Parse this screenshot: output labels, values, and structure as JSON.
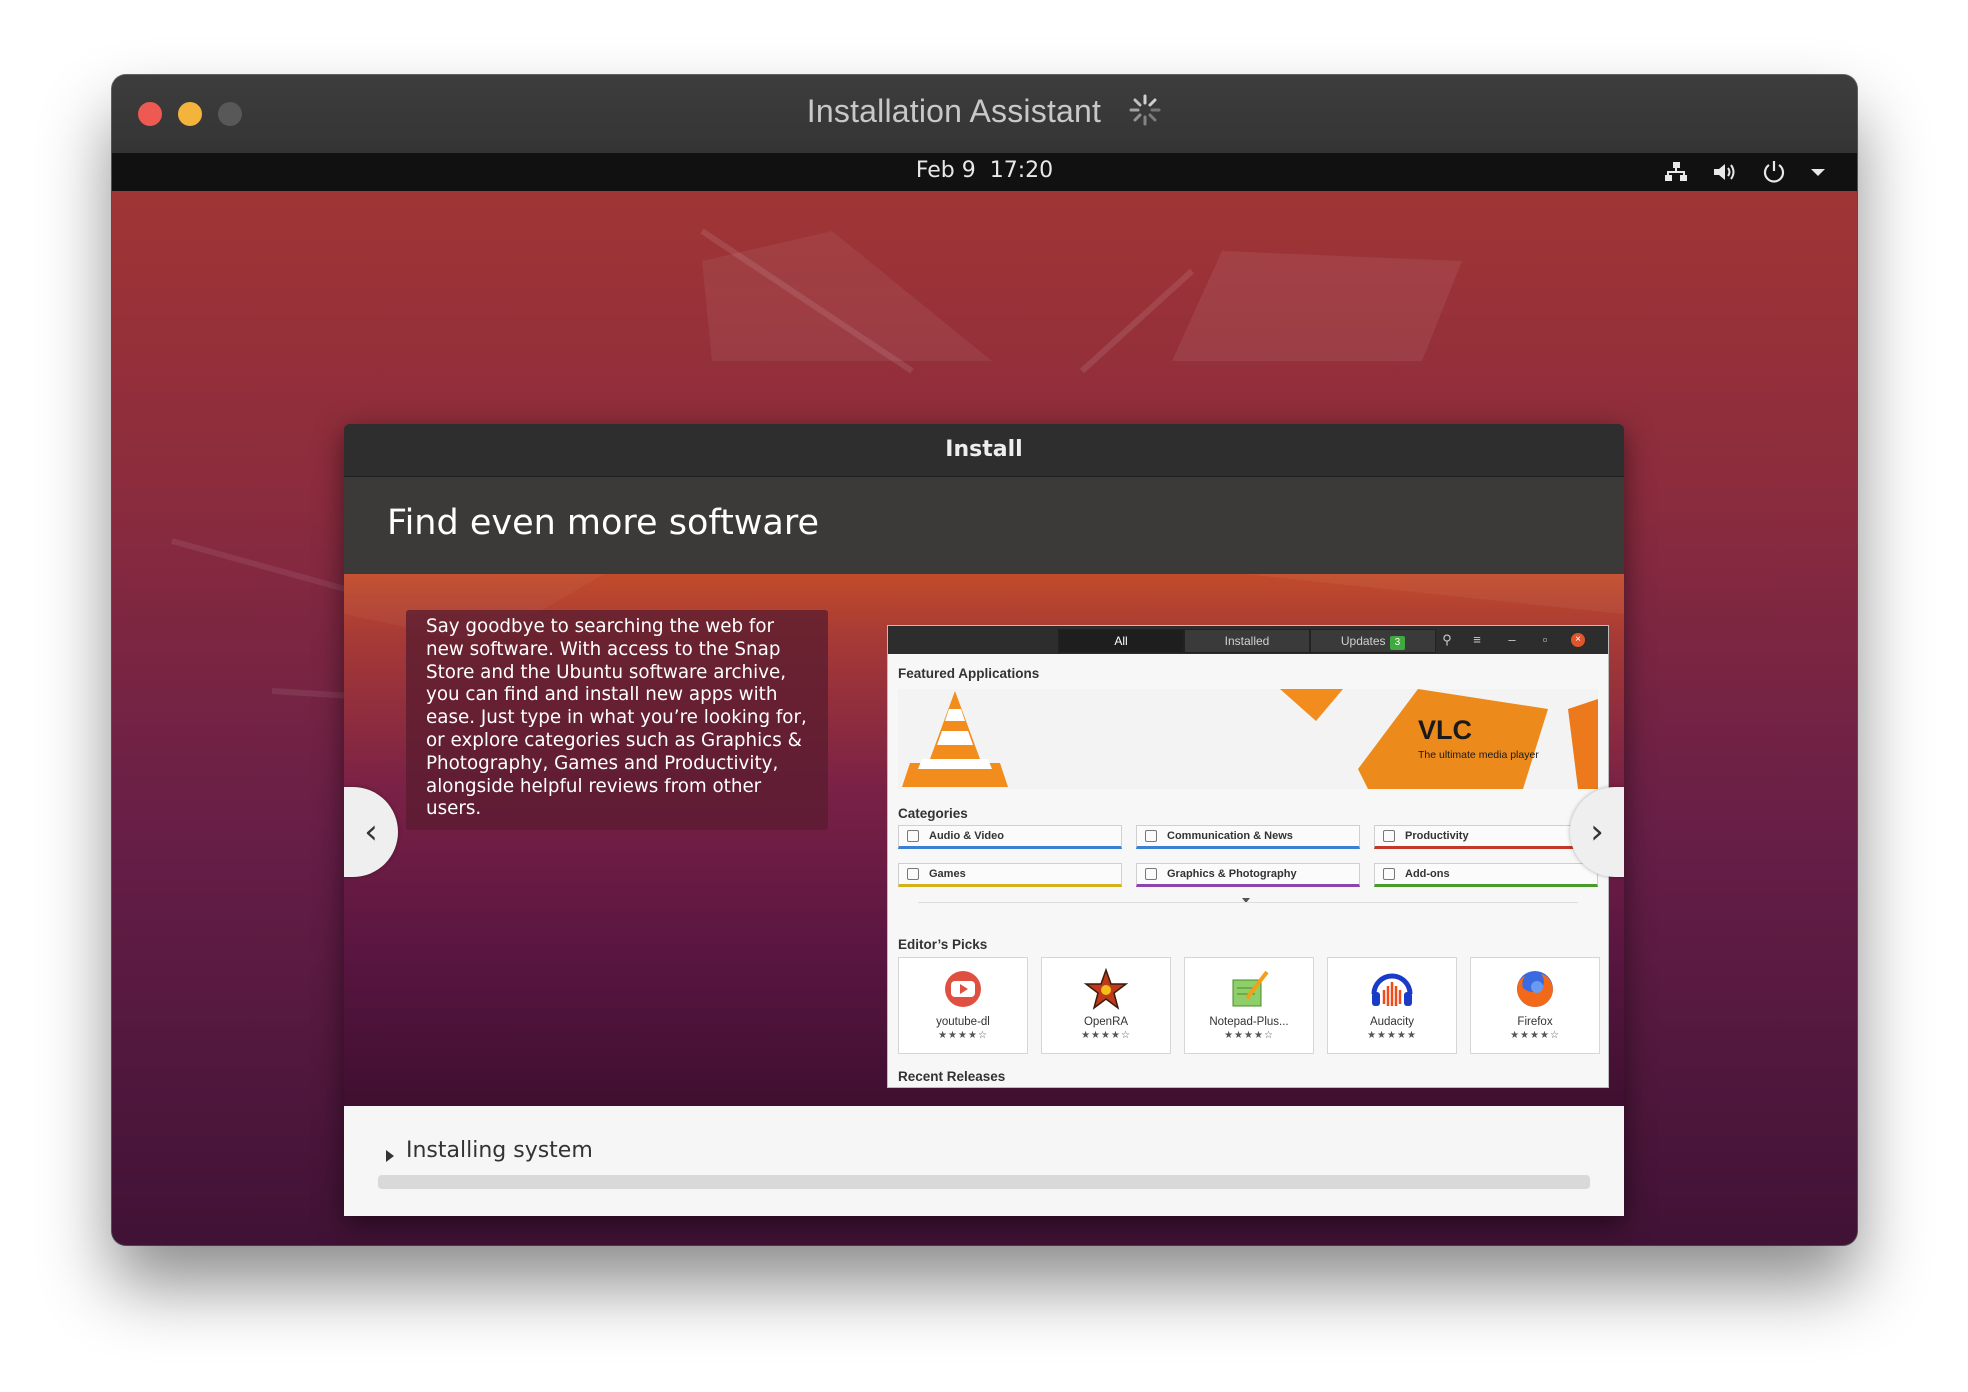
{
  "window": {
    "title": "Installation Assistant"
  },
  "panel": {
    "date": "Feb 9",
    "time": "17:20"
  },
  "dialog": {
    "title": "Install",
    "slide_title": "Find even more software",
    "slide_text": "Say goodbye to searching the web for new software. With access to the Snap Store and the Ubuntu software archive, you can find and install new apps with ease. Just type in what you’re looking for, or explore categories such as Graphics & Photography, Games and Productivity, alongside helpful reviews from other users.",
    "prev_label": "‹",
    "next_label": "›"
  },
  "store": {
    "tabs": [
      "All",
      "Installed",
      "Updates"
    ],
    "updates_count": "3",
    "featured_heading": "Featured Applications",
    "featured_app": "VLC",
    "featured_tagline": "The ultimate media player",
    "categories_heading": "Categories",
    "categories": [
      {
        "label": "Audio & Video",
        "color": "#3c7fd3"
      },
      {
        "label": "Communication & News",
        "color": "#3c7fd3"
      },
      {
        "label": "Productivity",
        "color": "#c0392b"
      },
      {
        "label": "Games",
        "color": "#d4b21a"
      },
      {
        "label": "Graphics & Photography",
        "color": "#8e44ad"
      },
      {
        "label": "Add-ons",
        "color": "#4a9a2c"
      }
    ],
    "editors_heading": "Editor’s Picks",
    "picks": [
      {
        "name": "youtube-dl",
        "stars": "★★★★☆",
        "icon": "youtube-icon"
      },
      {
        "name": "OpenRA",
        "stars": "★★★★☆",
        "icon": "openra-icon"
      },
      {
        "name": "Notepad-Plus...",
        "stars": "★★★★☆",
        "icon": "notepad-icon"
      },
      {
        "name": "Audacity",
        "stars": "★★★★★",
        "icon": "audacity-icon"
      },
      {
        "name": "Firefox",
        "stars": "★★★★☆",
        "icon": "firefox-icon"
      }
    ],
    "recent_heading": "Recent Releases"
  },
  "progress": {
    "label": "Installing system",
    "fraction": 0.0
  },
  "colors": {
    "accent": "#e95420",
    "close": "#ee5a52",
    "minimize": "#f4b33b"
  }
}
